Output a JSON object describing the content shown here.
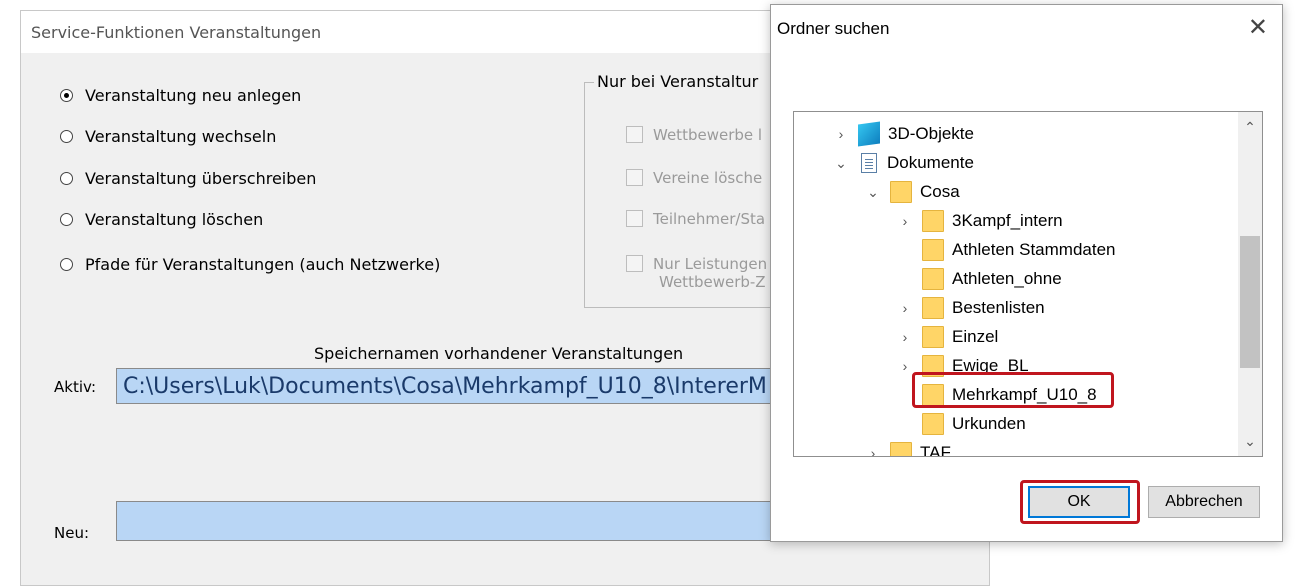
{
  "background_window": {
    "title": "Service-Funktionen Veranstaltungen",
    "radio_options": [
      {
        "label": "Veranstaltung neu anlegen",
        "checked": true
      },
      {
        "label": "Veranstaltung wechseln",
        "checked": false
      },
      {
        "label": "Veranstaltung überschreiben",
        "checked": false
      },
      {
        "label": "Veranstaltung löschen",
        "checked": false
      },
      {
        "label": "Pfade für Veranstaltungen (auch Netzwerke)",
        "checked": false
      }
    ],
    "group_title": "Nur bei Veranstaltur",
    "checkboxes": [
      {
        "label": "Wettbewerbe l"
      },
      {
        "label": "Vereine lösche"
      },
      {
        "label": "Teilnehmer/Sta"
      },
      {
        "label": "Nur Leistungen",
        "label2": "Wettbewerb-Z"
      }
    ],
    "section_label": "Speichernamen vorhandener Veranstaltungen",
    "aktiv_label": "Aktiv:",
    "aktiv_value": "C:\\Users\\Luk\\Documents\\Cosa\\Mehrkampf_U10_8\\IntererM",
    "neu_label": "Neu:",
    "neu_value": ""
  },
  "dialog": {
    "title": "Ordner suchen",
    "close_glyph": "✕",
    "tree": [
      {
        "label": "3D-Objekte",
        "expander": "›",
        "icon": "3d-objects"
      },
      {
        "label": "Dokumente",
        "expander": "⌄",
        "icon": "document"
      },
      {
        "label": "Cosa",
        "expander": "⌄",
        "icon": "folder"
      },
      {
        "label": "3Kampf_intern",
        "expander": "›",
        "icon": "folder"
      },
      {
        "label": "Athleten Stammdaten",
        "expander": "",
        "icon": "folder"
      },
      {
        "label": "Athleten_ohne",
        "expander": "",
        "icon": "folder"
      },
      {
        "label": "Bestenlisten",
        "expander": "›",
        "icon": "folder"
      },
      {
        "label": "Einzel",
        "expander": "›",
        "icon": "folder"
      },
      {
        "label": "Ewige_BL",
        "expander": "›",
        "icon": "folder"
      },
      {
        "label": "Mehrkampf_U10_8",
        "expander": "",
        "icon": "folder",
        "selected": true
      },
      {
        "label": "Urkunden",
        "expander": "",
        "icon": "folder"
      },
      {
        "label": "TAF",
        "expander": "›",
        "icon": "folder"
      }
    ],
    "scroll_up": "⌃",
    "scroll_down": "⌄",
    "ok_label": "OK",
    "cancel_label": "Abbrechen"
  },
  "colors": {
    "highlight": "#c0151e",
    "input_bg": "#b9d6f5",
    "folder": "#ffd567"
  }
}
